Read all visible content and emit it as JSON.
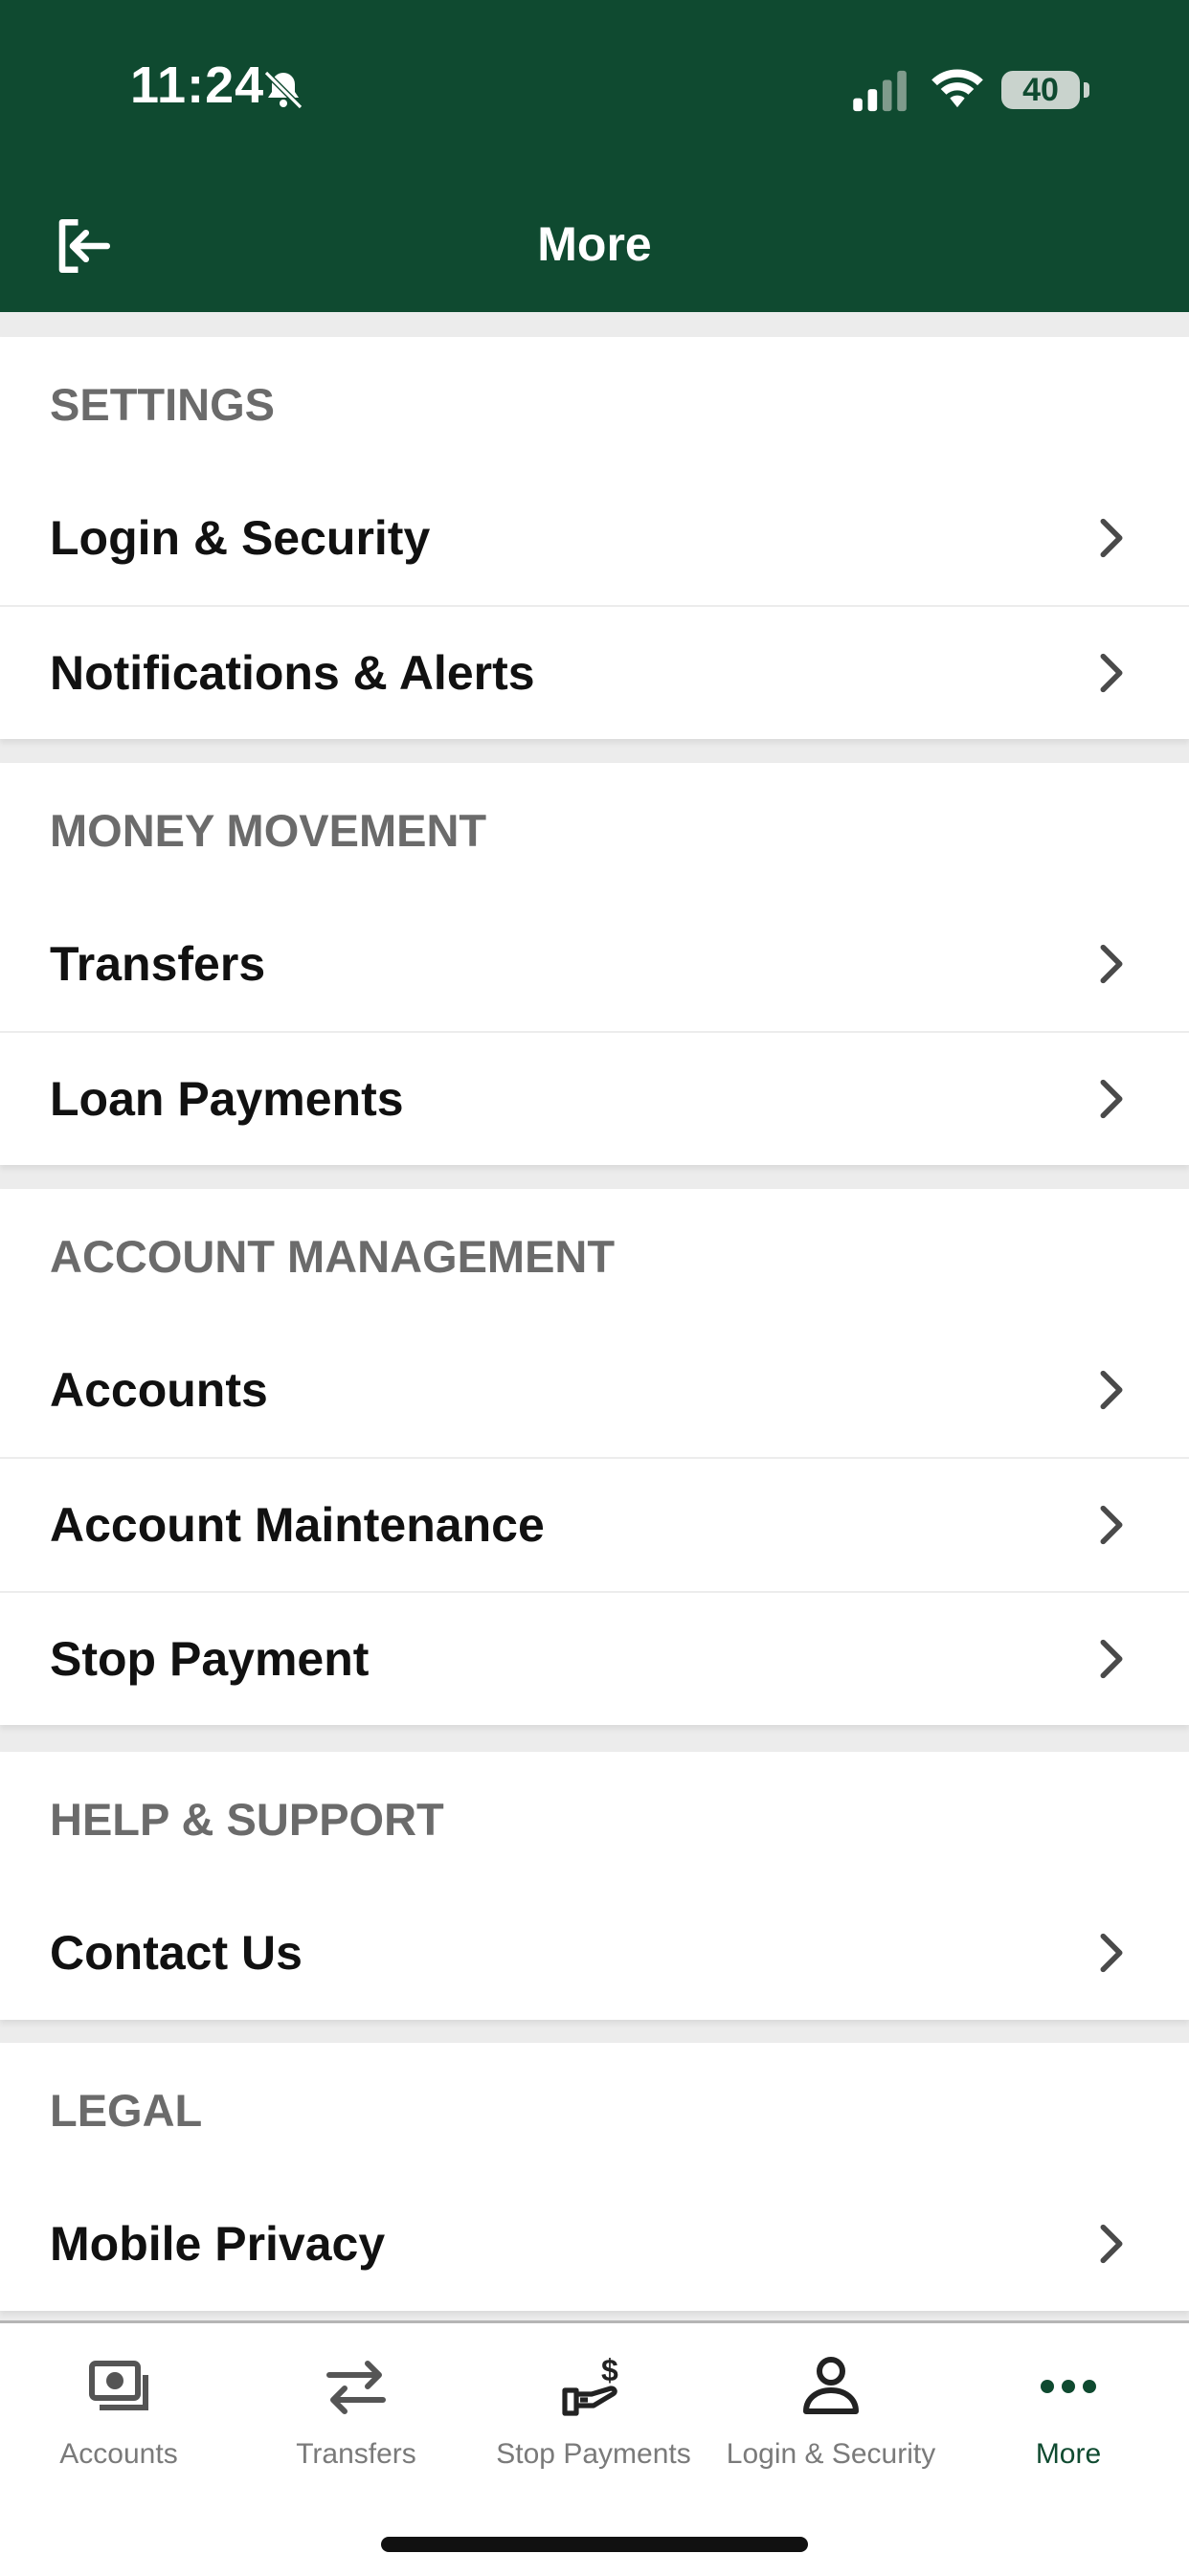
{
  "status_bar": {
    "time": "11:24",
    "battery": "40"
  },
  "header": {
    "title": "More"
  },
  "sections": [
    {
      "title": "SETTINGS",
      "items": [
        "Login & Security",
        "Notifications & Alerts"
      ]
    },
    {
      "title": "MONEY MOVEMENT",
      "items": [
        "Transfers",
        "Loan Payments"
      ]
    },
    {
      "title": "ACCOUNT MANAGEMENT",
      "items": [
        "Accounts",
        "Account Maintenance",
        "Stop Payment"
      ]
    },
    {
      "title": "HELP & SUPPORT",
      "items": [
        "Contact Us"
      ]
    },
    {
      "title": "LEGAL",
      "items": [
        "Mobile Privacy"
      ]
    }
  ],
  "tabbar": {
    "tabs": [
      {
        "label": "Accounts",
        "icon": "accounts-icon"
      },
      {
        "label": "Transfers",
        "icon": "transfer-arrows-icon"
      },
      {
        "label": "Stop Payments",
        "icon": "hand-dollar-icon"
      },
      {
        "label": "Login & Security",
        "icon": "person-icon"
      },
      {
        "label": "More",
        "icon": "more-dots-icon"
      }
    ],
    "active": "More"
  },
  "colors": {
    "brand": "#0f4a30",
    "section_header": "#6b6b6b",
    "text": "#111111",
    "inactive_tab": "#7a7a7a"
  }
}
